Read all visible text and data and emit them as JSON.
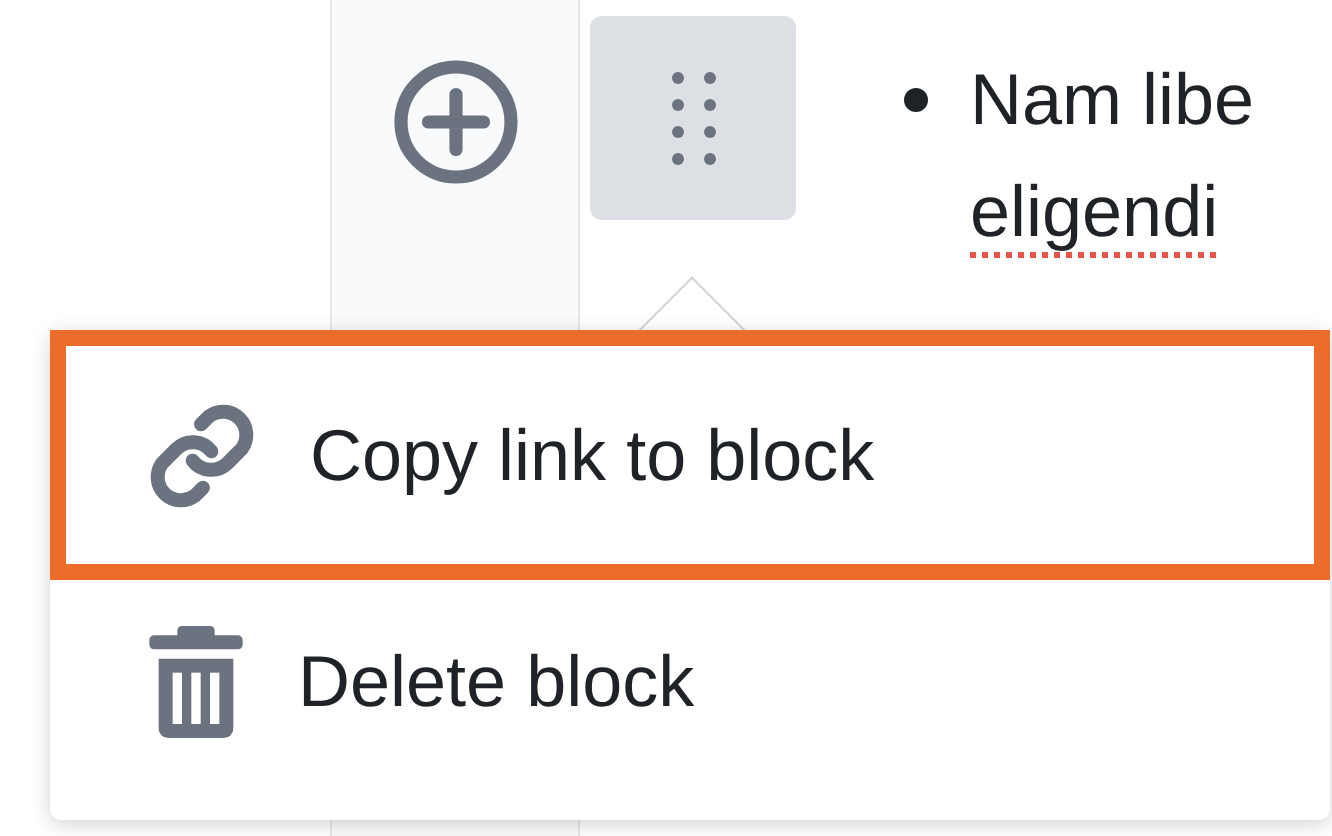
{
  "editor": {
    "lines": [
      {
        "text": "Nam libe",
        "bullet": true,
        "misspelled": false
      },
      {
        "text": "eligendi",
        "bullet": false,
        "misspelled": true
      }
    ]
  },
  "block_menu": {
    "items": [
      {
        "kind": "link",
        "label": "Copy link to block",
        "selected": true
      },
      {
        "kind": "trash",
        "label": "Delete block",
        "selected": false
      }
    ]
  }
}
